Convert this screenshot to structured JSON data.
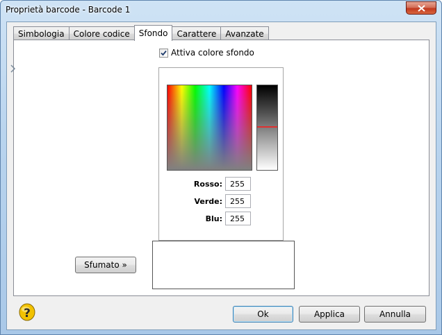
{
  "window": {
    "title": "Proprietà barcode - Barcode 1"
  },
  "tabs": [
    {
      "label": "Simbologia",
      "active": false
    },
    {
      "label": "Colore codice",
      "active": false
    },
    {
      "label": "Sfondo",
      "active": true
    },
    {
      "label": "Carattere",
      "active": false
    },
    {
      "label": "Avanzate",
      "active": false
    }
  ],
  "background": {
    "enable_label": "Attiva colore sfondo",
    "enabled": true,
    "fields": [
      {
        "label": "Rosso:",
        "value": "255"
      },
      {
        "label": "Verde:",
        "value": "255"
      },
      {
        "label": "Blu:",
        "value": "255"
      }
    ],
    "gradient_button": "Sfumato »",
    "preview_color": "#ffffff"
  },
  "footer": {
    "ok": "Ok",
    "apply": "Applica",
    "cancel": "Annulla"
  },
  "colors": {
    "accent": "#3c7fb1",
    "luminance_marker": "#e03030",
    "close_button": "#c1391f"
  },
  "icons": {
    "close": "close-icon",
    "help": "help-icon",
    "checkbox": "checkmark-icon"
  }
}
